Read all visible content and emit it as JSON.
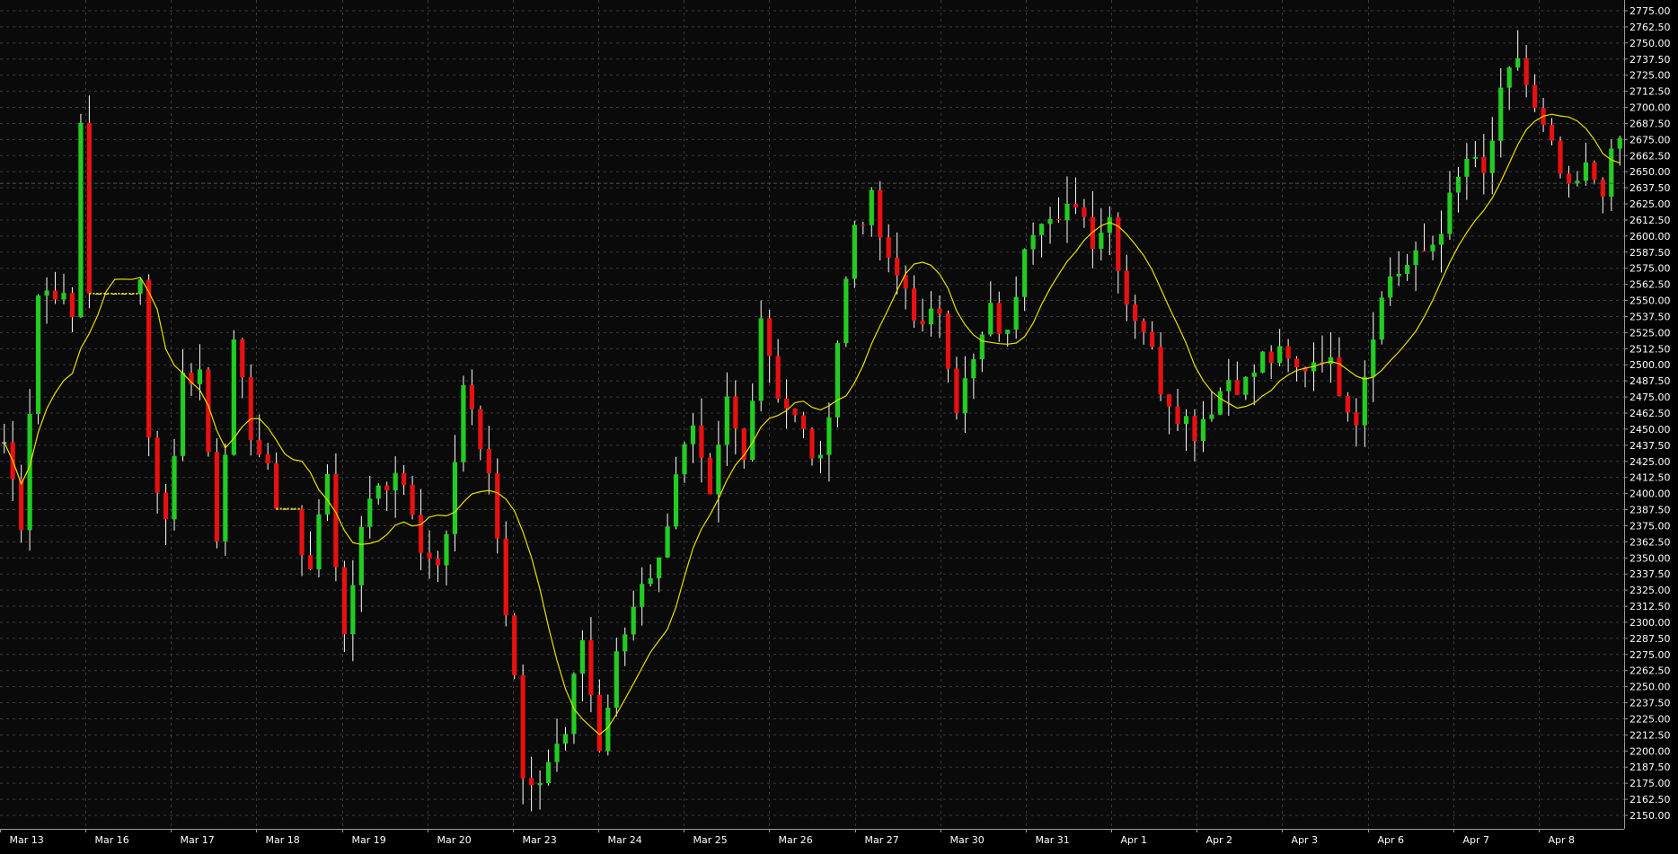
{
  "theme": {
    "background": "#000000",
    "plot_background": "#0a0a0a",
    "grid_color": "#3a3a3a",
    "axis_color": "#9a9a9a",
    "text_color": "#ffffff",
    "up_color": "#22cc22",
    "down_color": "#e81010",
    "flat_color": "#ffffff",
    "ma_color": "#e8e000",
    "crosshair_color": "#555555"
  },
  "chart_data": {
    "type": "candlestick",
    "title": "",
    "xlabel": "",
    "ylabel": "",
    "ylim": [
      2150,
      2775
    ],
    "y_tick_step": 12.5,
    "y_tick_labels": [
      "2150.00",
      "2162.50",
      "2175.00",
      "2187.50",
      "2200.00",
      "2212.50",
      "2225.00",
      "2237.50",
      "2250.00",
      "2262.50",
      "2275.00",
      "2287.50",
      "2300.00",
      "2312.50",
      "2325.00",
      "2337.50",
      "2350.00",
      "2362.50",
      "2375.00",
      "2387.50",
      "2400.00",
      "2412.50",
      "2425.00",
      "2437.50",
      "2450.00",
      "2462.50",
      "2475.00",
      "2487.50",
      "2500.00",
      "2512.50",
      "2525.00",
      "2537.50",
      "2550.00",
      "2562.50",
      "2575.00",
      "2587.50",
      "2600.00",
      "2612.50",
      "2625.00",
      "2637.50",
      "2650.00",
      "2662.50",
      "2675.00",
      "2687.50",
      "2700.00",
      "2712.50",
      "2725.00",
      "2737.50",
      "2750.00",
      "2762.50",
      "2775.00"
    ],
    "x_labels": [
      "Mar 13",
      "Mar 16",
      "Mar 17",
      "Mar 18",
      "Mar 19",
      "Mar 20",
      "Mar 23",
      "Mar 24",
      "Mar 25",
      "Mar 26",
      "Mar 27",
      "Mar 30",
      "Mar 31",
      "Apr 1",
      "Apr 2",
      "Apr 3",
      "Apr 6",
      "Apr 7",
      "Apr 8"
    ],
    "crosshair_price": 2641,
    "moving_average": {
      "visible": true
    },
    "anchor_closes": [
      [
        0,
        2440
      ],
      [
        2,
        2380
      ],
      [
        4,
        2555
      ],
      [
        6,
        2560
      ],
      [
        8,
        2535
      ],
      [
        9,
        2690
      ],
      [
        10,
        2560
      ],
      [
        16,
        2560
      ],
      [
        17,
        2440
      ],
      [
        19,
        2380
      ],
      [
        21,
        2490
      ],
      [
        23,
        2495
      ],
      [
        25,
        2370
      ],
      [
        27,
        2510
      ],
      [
        29,
        2450
      ],
      [
        32,
        2395
      ],
      [
        36,
        2340
      ],
      [
        38,
        2420
      ],
      [
        40,
        2280
      ],
      [
        42,
        2380
      ],
      [
        44,
        2410
      ],
      [
        47,
        2410
      ],
      [
        50,
        2340
      ],
      [
        52,
        2360
      ],
      [
        54,
        2490
      ],
      [
        57,
        2410
      ],
      [
        60,
        2265
      ],
      [
        61,
        2180
      ],
      [
        63,
        2185
      ],
      [
        66,
        2210
      ],
      [
        68,
        2290
      ],
      [
        70,
        2200
      ],
      [
        72,
        2270
      ],
      [
        75,
        2335
      ],
      [
        77,
        2345
      ],
      [
        79,
        2420
      ],
      [
        81,
        2445
      ],
      [
        83,
        2390
      ],
      [
        85,
        2470
      ],
      [
        87,
        2425
      ],
      [
        89,
        2540
      ],
      [
        91,
        2480
      ],
      [
        94,
        2445
      ],
      [
        96,
        2420
      ],
      [
        98,
        2520
      ],
      [
        100,
        2610
      ],
      [
        102,
        2625
      ],
      [
        104,
        2575
      ],
      [
        106,
        2560
      ],
      [
        108,
        2525
      ],
      [
        110,
        2545
      ],
      [
        112,
        2470
      ],
      [
        114,
        2500
      ],
      [
        116,
        2540
      ],
      [
        118,
        2520
      ],
      [
        120,
        2600
      ],
      [
        122,
        2620
      ],
      [
        124,
        2605
      ],
      [
        126,
        2630
      ],
      [
        128,
        2600
      ],
      [
        130,
        2615
      ],
      [
        132,
        2550
      ],
      [
        134,
        2530
      ],
      [
        136,
        2485
      ],
      [
        138,
        2465
      ],
      [
        140,
        2450
      ],
      [
        142,
        2470
      ],
      [
        144,
        2490
      ],
      [
        146,
        2485
      ],
      [
        148,
        2505
      ],
      [
        150,
        2505
      ],
      [
        152,
        2495
      ],
      [
        155,
        2510
      ],
      [
        157,
        2485
      ],
      [
        159,
        2460
      ],
      [
        161,
        2530
      ],
      [
        163,
        2570
      ],
      [
        166,
        2580
      ],
      [
        168,
        2595
      ],
      [
        170,
        2625
      ],
      [
        172,
        2660
      ],
      [
        174,
        2645
      ],
      [
        176,
        2705
      ],
      [
        178,
        2740
      ],
      [
        180,
        2695
      ],
      [
        182,
        2665
      ],
      [
        184,
        2630
      ],
      [
        186,
        2650
      ],
      [
        188,
        2640
      ],
      [
        190,
        2675
      ]
    ],
    "flat_segments": [
      [
        10,
        16
      ],
      [
        32,
        35
      ]
    ]
  }
}
